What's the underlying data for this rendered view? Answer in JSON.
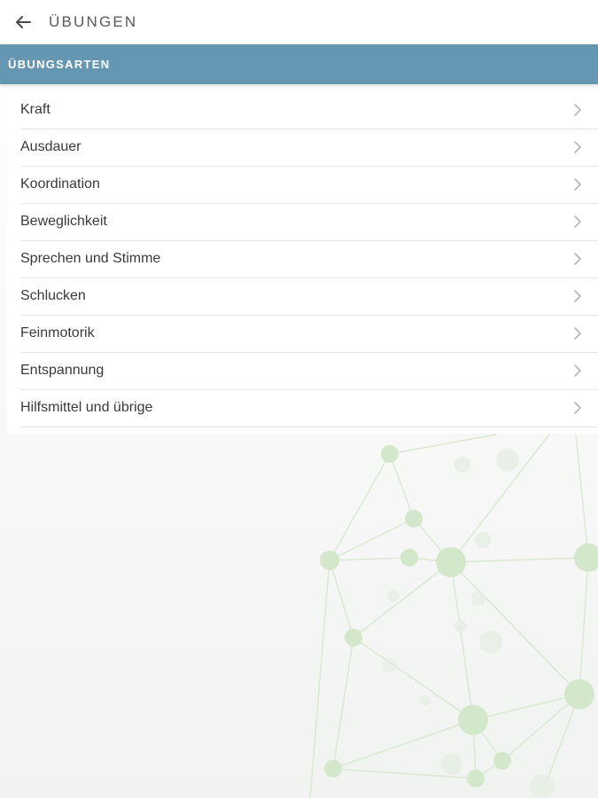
{
  "header": {
    "back_icon": "arrow-left-icon",
    "title": "ÜBUNGEN"
  },
  "section": {
    "title": "ÜBUNGSARTEN",
    "color": "#6597b3"
  },
  "categories": [
    {
      "label": "Kraft"
    },
    {
      "label": "Ausdauer"
    },
    {
      "label": "Koordination"
    },
    {
      "label": "Beweglichkeit"
    },
    {
      "label": "Sprechen und Stimme"
    },
    {
      "label": "Schlucken"
    },
    {
      "label": "Feinmotorik"
    },
    {
      "label": "Entspannung"
    },
    {
      "label": "Hilfsmittel und übrige"
    }
  ],
  "row_icon": "chevron-right-icon",
  "background_decoration": "network-graph-illustration"
}
